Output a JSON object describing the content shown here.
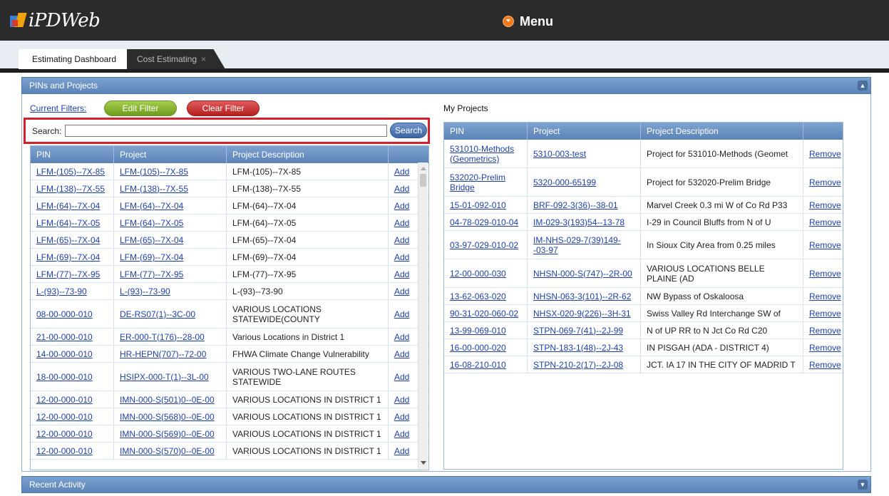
{
  "app": {
    "logo_text": "iPDWeb",
    "menu_label": "Menu"
  },
  "tabs": [
    {
      "label": "Estimating Dashboard",
      "active": true
    },
    {
      "label": "Cost Estimating",
      "active": false,
      "close": "×"
    }
  ],
  "panel": {
    "title": "PINs and Projects",
    "toggle": "▲"
  },
  "filters": {
    "current_label": "Current Filters:",
    "edit_label": "Edit Filter",
    "clear_label": "Clear Filter"
  },
  "search": {
    "label": "Search:",
    "value": "",
    "button": "Search"
  },
  "left_table": {
    "headers": [
      "PIN",
      "Project",
      "Project Description",
      ""
    ],
    "rows": [
      {
        "pin": "LFM-(105)--7X-85",
        "project": "LFM-(105)--7X-85",
        "desc": "LFM-(105)--7X-85",
        "action": "Add"
      },
      {
        "pin": "LFM-(138)--7X-55",
        "project": "LFM-(138)--7X-55",
        "desc": "LFM-(138)--7X-55",
        "action": "Add"
      },
      {
        "pin": "LFM-(64)--7X-04",
        "project": "LFM-(64)--7X-04",
        "desc": "LFM-(64)--7X-04",
        "action": "Add"
      },
      {
        "pin": "LFM-(64)--7X-05",
        "project": "LFM-(64)--7X-05",
        "desc": "LFM-(64)--7X-05",
        "action": "Add"
      },
      {
        "pin": "LFM-(65)--7X-04",
        "project": "LFM-(65)--7X-04",
        "desc": "LFM-(65)--7X-04",
        "action": "Add"
      },
      {
        "pin": "LFM-(69)--7X-04",
        "project": "LFM-(69)--7X-04",
        "desc": "LFM-(69)--7X-04",
        "action": "Add"
      },
      {
        "pin": "LFM-(77)--7X-95",
        "project": "LFM-(77)--7X-95",
        "desc": "LFM-(77)--7X-95",
        "action": "Add"
      },
      {
        "pin": "L-(93)--73-90",
        "project": "L-(93)--73-90",
        "desc": "L-(93)--73-90",
        "action": "Add"
      },
      {
        "pin": "08-00-000-010",
        "project": "DE-RS07(1)--3C-00",
        "desc": "VARIOUS LOCATIONS STATEWIDE(COUNTY",
        "action": "Add"
      },
      {
        "pin": "21-00-000-010",
        "project": "ER-000-T(176)--28-00",
        "desc": "Various Locations in District 1",
        "action": "Add"
      },
      {
        "pin": "14-00-000-010",
        "project": "HR-HEPN(707)--72-00",
        "desc": "FHWA Climate Change Vulnerability",
        "action": "Add"
      },
      {
        "pin": "18-00-000-010",
        "project": "HSIPX-000-T(1)--3L-00",
        "desc": "VARIOUS TWO-LANE ROUTES STATEWIDE",
        "action": "Add"
      },
      {
        "pin": "12-00-000-010",
        "project": "IMN-000-S(501)0--0E-00",
        "desc": "VARIOUS LOCATIONS IN DISTRICT 1",
        "action": "Add"
      },
      {
        "pin": "12-00-000-010",
        "project": "IMN-000-S(568)0--0E-00",
        "desc": "VARIOUS LOCATIONS IN DISTRICT 1",
        "action": "Add"
      },
      {
        "pin": "12-00-000-010",
        "project": "IMN-000-S(569)0--0E-00",
        "desc": "VARIOUS LOCATIONS IN DISTRICT 1",
        "action": "Add"
      },
      {
        "pin": "12-00-000-010",
        "project": "IMN-000-S(570)0--0E-00",
        "desc": "VARIOUS LOCATIONS IN DISTRICT 1",
        "action": "Add"
      }
    ]
  },
  "my_projects": {
    "title": "My Projects",
    "headers": [
      "PIN",
      "Project",
      "Project Description",
      ""
    ],
    "rows": [
      {
        "pin": "531010-Methods (Geometrics)",
        "project": "5310-003-test",
        "desc": "Project for 531010-Methods (Geomet",
        "action": "Remove"
      },
      {
        "pin": "532020-Prelim Bridge",
        "project": "5320-000-65199",
        "desc": "Project for 532020-Prelim Bridge",
        "action": "Remove"
      },
      {
        "pin": "15-01-092-010",
        "project": "BRF-092-3(36)--38-01",
        "desc": "Marvel Creek 0.3 mi W of Co Rd P33",
        "action": "Remove"
      },
      {
        "pin": "04-78-029-010-04",
        "project": "IM-029-3(193)54--13-78",
        "desc": "I-29 in Council Bluffs from N of U",
        "action": "Remove"
      },
      {
        "pin": "03-97-029-010-02",
        "project": "IM-NHS-029-7(39)149--03-97",
        "desc": "In Sioux City Area from 0.25 miles",
        "action": "Remove"
      },
      {
        "pin": "12-00-000-030",
        "project": "NHSN-000-S(747)--2R-00",
        "desc": "VARIOUS LOCATIONS BELLE PLAINE (AD",
        "action": "Remove"
      },
      {
        "pin": "13-62-063-020",
        "project": "NHSN-063-3(101)--2R-62",
        "desc": "NW Bypass of Oskaloosa",
        "action": "Remove"
      },
      {
        "pin": "90-31-020-060-02",
        "project": "NHSX-020-9(226)--3H-31",
        "desc": "Swiss Valley Rd Interchange SW of",
        "action": "Remove"
      },
      {
        "pin": "13-99-069-010",
        "project": "STPN-069-7(41)--2J-99",
        "desc": "N of UP RR to N Jct Co Rd C20",
        "action": "Remove"
      },
      {
        "pin": "16-00-000-020",
        "project": "STPN-183-1(48)--2J-43",
        "desc": "IN PISGAH (ADA - DISTRICT 4)",
        "action": "Remove"
      },
      {
        "pin": "16-08-210-010",
        "project": "STPN-210-2(17)--2J-08",
        "desc": "JCT. IA 17 IN THE CITY OF MADRID T",
        "action": "Remove"
      }
    ]
  },
  "recent": {
    "title": "Recent Activity",
    "toggle": "▼"
  },
  "colors": {
    "header_bg": "#2b2b2b",
    "accent": "#5c84b8",
    "link": "#1f3fa8",
    "highlight": "#d3202a"
  }
}
